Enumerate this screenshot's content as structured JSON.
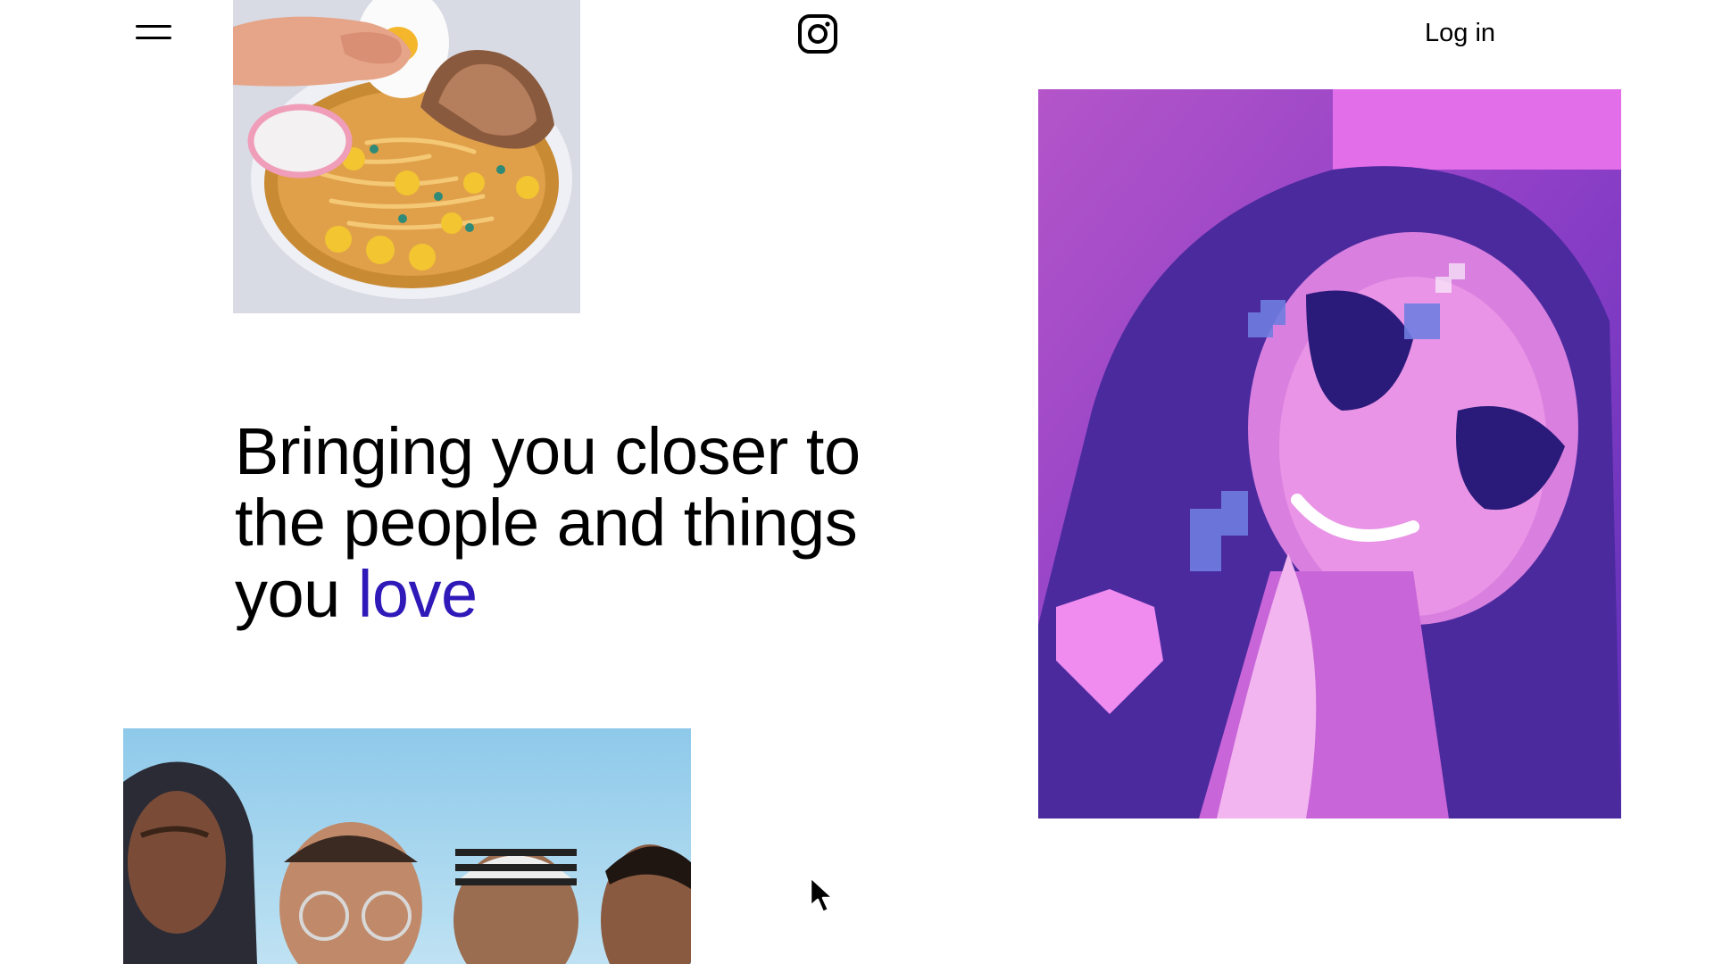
{
  "header": {
    "menu_icon": "hamburger-menu-icon",
    "logo_icon": "instagram-logo-icon",
    "login_label": "Log in"
  },
  "hero": {
    "headline_line1": "Bringing you closer to",
    "headline_line2": "the people and things",
    "headline_line3_prefix": "you ",
    "headline_accent": "love",
    "accent_color": "#2f19b8"
  },
  "images": [
    {
      "name": "photo-food",
      "icon": "ramen-bowl-image"
    },
    {
      "name": "photo-portrait",
      "icon": "woman-heart-sunglasses-image"
    },
    {
      "name": "photo-group",
      "icon": "group-of-friends-image"
    }
  ]
}
